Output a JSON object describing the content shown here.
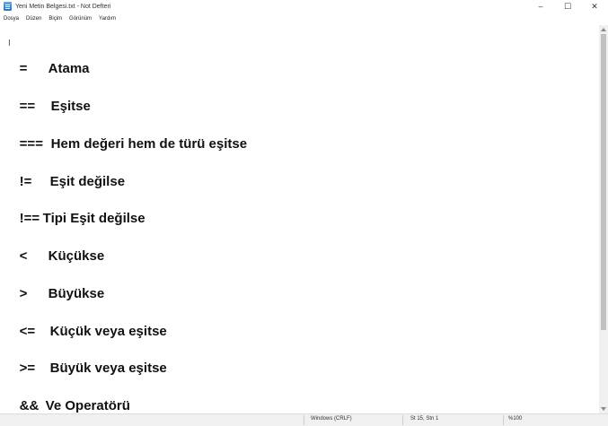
{
  "window": {
    "title": "Yeni Metin Belgesi.txt - Not Defteri",
    "controls": {
      "minimize": "–",
      "maximize": "☐",
      "close": "✕"
    }
  },
  "menu": [
    "Dosya",
    "Düzen",
    "Biçim",
    "Görünüm",
    "Yardım"
  ],
  "editor": {
    "lines": [
      {
        "op": "=",
        "text": "Atama"
      },
      {
        "op": "==",
        "text": "Eşitse"
      },
      {
        "op": "===",
        "text": "Hem değeri hem de türü eşitse"
      },
      {
        "op": "!=",
        "text": "Eşit değilse"
      },
      {
        "op": "!==",
        "text": "Tipi Eşit değilse"
      },
      {
        "op": "<",
        "text": "Küçükse"
      },
      {
        "op": ">",
        "text": "Büyükse"
      },
      {
        "op": "<=",
        "text": "Küçük veya eşitse"
      },
      {
        "op": ">=",
        "text": "Büyük veya eşitse"
      },
      {
        "op": "&&",
        "text": "Ve Operatörü"
      }
    ]
  },
  "status": {
    "line_ending": "Windows (CRLF)",
    "position": "St 15, Stn 1",
    "zoom": "%100"
  }
}
